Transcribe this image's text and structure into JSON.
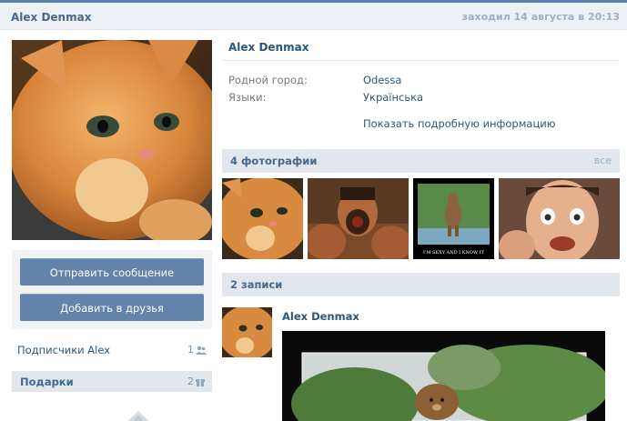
{
  "header": {
    "name": "Alex Denmax",
    "last_seen": "заходил 14 августа в 20:13"
  },
  "left": {
    "send_message_label": "Отправить сообщение",
    "add_friend_label": "Добавить в друзья",
    "subscribers_label": "Подписчики Alex",
    "subscribers_count": "1",
    "gifts_label": "Подарки",
    "gifts_count": "2"
  },
  "profile": {
    "name": "Alex Denmax",
    "info": [
      {
        "key": "Родной город:",
        "value": "Odessa"
      },
      {
        "key": "Языки:",
        "value": "Українська"
      }
    ],
    "more_label": "Показать подробную информацию"
  },
  "photos": {
    "title": "4 фотографии",
    "all_label": "все",
    "caption3": "I'M SEXY AND I KNOW IT"
  },
  "posts": {
    "title": "2 записи",
    "author": "Alex Denmax"
  },
  "colors": {
    "link": "#2b587a",
    "button": "#6383a8",
    "section_bg": "#e1e7ed",
    "header_bg": "#edf1f5"
  }
}
